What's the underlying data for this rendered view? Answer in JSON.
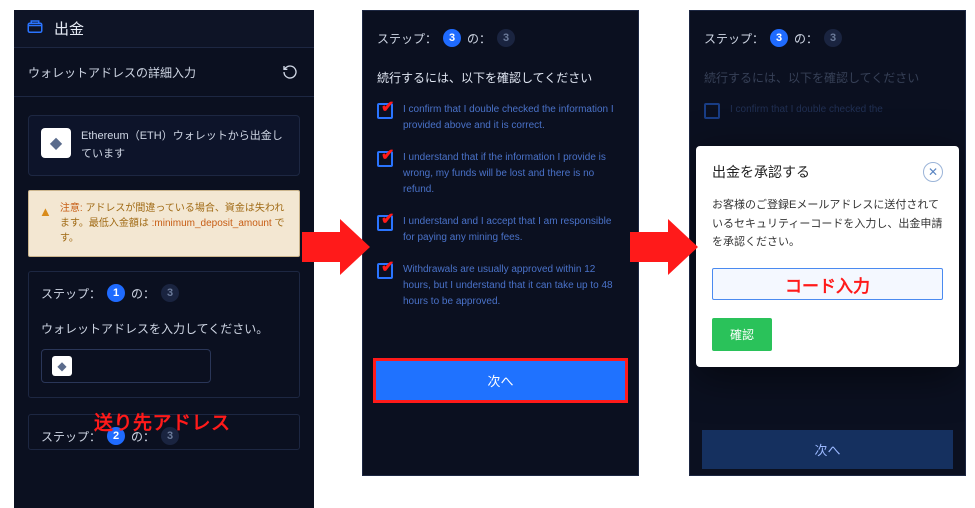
{
  "panel1": {
    "header_icon": "wallet",
    "title": "出金",
    "subheader": "ウォレットアドレスの詳細入力",
    "refresh_icon": "refresh",
    "eth_card": "Ethereum（ETH）ウォレットから出金しています",
    "warning": {
      "label": "注意:",
      "text_a": "アドレスが間違っている場合、資金は失われます。最低入金額は ",
      "code": ":minimum_deposit_amount",
      "text_b": " です。"
    },
    "step1": {
      "label_a": "ステップ：",
      "num": "1",
      "label_b": "の：",
      "total": "3",
      "desc": "ウォレットアドレスを入力してください。"
    },
    "overlay_addr": "送り先アドレス",
    "step2": {
      "label_a": "ステップ：",
      "num": "2",
      "label_b": "の：",
      "total": "3"
    }
  },
  "panel2": {
    "step": {
      "label_a": "ステップ：",
      "num": "3",
      "label_b": "の：",
      "total": "3"
    },
    "confirm_title": "続行するには、以下を確認してください",
    "checks": [
      "I confirm that I double checked the information I provided above and it is correct.",
      "I understand that if the information I provide is wrong, my funds will be lost and there is no refund.",
      "I understand and I accept that I am responsible for paying any mining fees.",
      "Withdrawals are usually approved within 12 hours, but I understand that it can take up to 48 hours to be approved."
    ],
    "next": "次へ"
  },
  "panel3": {
    "step": {
      "label_a": "ステップ：",
      "num": "3",
      "label_b": "の：",
      "total": "3"
    },
    "confirm_title": "続行するには、以下を確認してください",
    "check0": "I confirm that I double checked the",
    "modal": {
      "title": "出金を承認する",
      "body": "お客様のご登録Eメールアドレスに送付されているセキュリティーコードを入力し、出金申請を承認ください。",
      "code_overlay": "コード入力",
      "confirm": "確認"
    },
    "next": "次へ"
  }
}
